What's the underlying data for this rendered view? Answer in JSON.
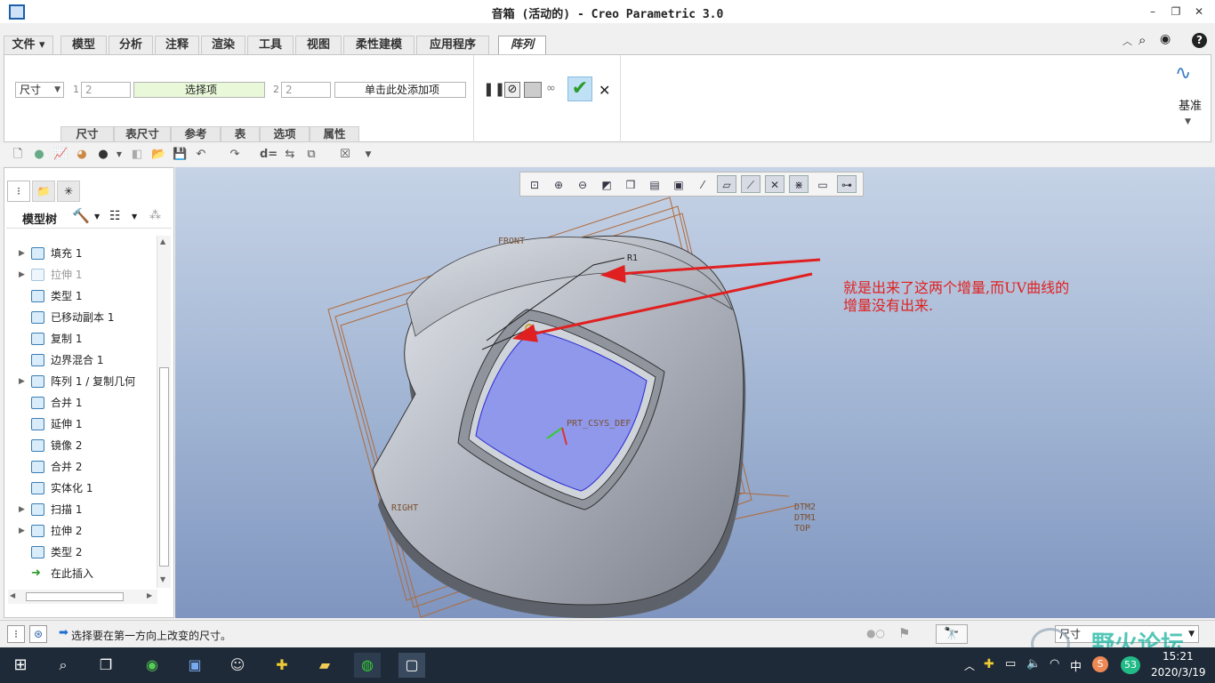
{
  "window": {
    "title": "音箱 (活动的) - Creo Parametric 3.0"
  },
  "menu_tabs": [
    "文件",
    "模型",
    "分析",
    "注释",
    "渲染",
    "工具",
    "视图",
    "柔性建模",
    "应用程序",
    "阵列"
  ],
  "ribbon": {
    "type_select": "尺寸",
    "dir1_num": "1",
    "dir1_count": "2",
    "dir1_select": "选择项",
    "dir2_num": "2",
    "dir2_count": "2",
    "dir2_select": "单击此处添加项",
    "datum_label": "基准",
    "subtabs": [
      "尺寸",
      "表尺寸",
      "参考",
      "表",
      "选项",
      "属性"
    ]
  },
  "model_tree": {
    "label": "模型树",
    "items": [
      {
        "label": "填充 1",
        "expandable": true,
        "dimmed": false
      },
      {
        "label": "拉伸 1",
        "expandable": true,
        "dimmed": true
      },
      {
        "label": "类型 1",
        "expandable": false,
        "dimmed": false
      },
      {
        "label": "已移动副本 1",
        "expandable": false,
        "dimmed": false
      },
      {
        "label": "复制 1",
        "expandable": false,
        "dimmed": false
      },
      {
        "label": "边界混合 1",
        "expandable": false,
        "dimmed": false
      },
      {
        "label": "阵列 1 / 复制几何",
        "expandable": true,
        "dimmed": false
      },
      {
        "label": "合并 1",
        "expandable": false,
        "dimmed": false
      },
      {
        "label": "延伸 1",
        "expandable": false,
        "dimmed": false
      },
      {
        "label": "镜像 2",
        "expandable": false,
        "dimmed": false
      },
      {
        "label": "合并 2",
        "expandable": false,
        "dimmed": false
      },
      {
        "label": "实体化 1",
        "expandable": false,
        "dimmed": false
      },
      {
        "label": "扫描 1",
        "expandable": true,
        "dimmed": false
      },
      {
        "label": "拉伸 2",
        "expandable": true,
        "dimmed": false
      },
      {
        "label": "类型 2",
        "expandable": false,
        "dimmed": false
      },
      {
        "label": "在此插入",
        "expandable": false,
        "dimmed": false
      }
    ]
  },
  "viewport": {
    "labels": {
      "front": "FRONT",
      "right": "RIGHT",
      "dtm2": "DTM2",
      "dtm1": "DTM1",
      "top": "TOP",
      "csys": "PRT_CSYS_DEF",
      "r1": "R1"
    },
    "annotation": "就是出来了这两个增量,而UV曲线的\n增量没有出来."
  },
  "status": {
    "message": "选择要在第一方向上改变的尺寸。",
    "filter": "尺寸"
  },
  "watermark": "野火论坛",
  "taskbar": {
    "ime": "中",
    "badge": "53",
    "time": "15:21",
    "date": "2020/3/19"
  },
  "colors": {
    "accent_green": "#3aa53a",
    "annotation_red": "#e02020",
    "taskbar_bg": "#1f2a38"
  }
}
